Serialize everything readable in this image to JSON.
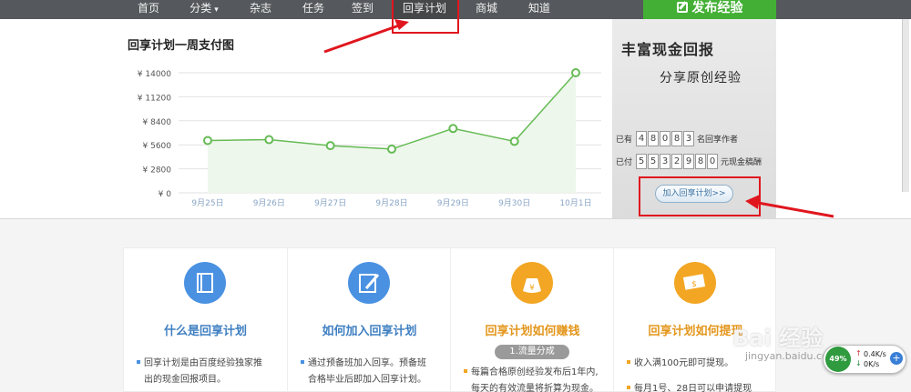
{
  "nav": {
    "items": [
      {
        "label": "首页",
        "has_caret": false,
        "active": false
      },
      {
        "label": "分类",
        "has_caret": true,
        "active": false
      },
      {
        "label": "杂志",
        "has_caret": false,
        "active": false
      },
      {
        "label": "任务",
        "has_caret": false,
        "active": false
      },
      {
        "label": "签到",
        "has_caret": false,
        "active": false
      },
      {
        "label": "回享计划",
        "has_caret": false,
        "active": true
      },
      {
        "label": "商城",
        "has_caret": false,
        "active": false
      },
      {
        "label": "知道",
        "has_caret": false,
        "active": false
      }
    ],
    "publish_label": "发布经验"
  },
  "chart_title": "回享计划一周支付图",
  "chart_data": {
    "type": "area",
    "categories": [
      "9月25日",
      "9月26日",
      "9月27日",
      "9月28日",
      "9月29日",
      "9月30日",
      "10月1日"
    ],
    "values": [
      6100,
      6200,
      5500,
      5100,
      7500,
      6000,
      14000
    ],
    "yticks": [
      "¥ 0",
      "¥ 2800",
      "¥ 5600",
      "¥ 8400",
      "¥ 11200",
      "¥ 14000"
    ],
    "ylim": [
      0,
      14000
    ],
    "line_color": "#66bb55",
    "fill_color": "#eef7ec",
    "grid": true
  },
  "promo": {
    "line1": "丰富现金回报",
    "line2": "分享原创经验",
    "author_prefix": "已有",
    "author_digits": [
      "4",
      "8",
      "0",
      "8",
      "3"
    ],
    "author_suffix": "名回享作者",
    "paid_prefix": "已付",
    "paid_digits": [
      "5",
      "5",
      "3",
      "2",
      "9",
      "8",
      "0"
    ],
    "paid_suffix": "元现金稿酬",
    "join_label": "加入回享计划>>"
  },
  "cards": [
    {
      "title": "什么是回享计划",
      "icon": "book-icon",
      "color": "blue",
      "lines": [
        "回享计划是由百度经验独家推",
        "出的现金回报项目。"
      ]
    },
    {
      "title": "如何加入回享计划",
      "icon": "edit-icon",
      "color": "blue",
      "lines": [
        "通过预备班加入回享。预备班",
        "合格毕业后即加入回享计划。"
      ]
    },
    {
      "title": "回享计划如何赚钱",
      "icon": "money-bag-icon",
      "color": "orange",
      "badge": "1.流量分成",
      "lines": [
        "每篇合格原创经验发布后1年内,",
        "每天的有效流量将折算为现金。"
      ]
    },
    {
      "title": "回享计划如何提现",
      "icon": "cash-icon",
      "color": "orange",
      "lines": [
        "收入满100元即可提现。",
        "每月1号、28日可以申请提现"
      ]
    }
  ],
  "watermark": {
    "brand": "Bai 经验",
    "url": "jingyan.baidu.com"
  },
  "netwidget": {
    "percent": "49%",
    "up": "0.4K/s",
    "down": "0K/s"
  },
  "colors": {
    "accent_green": "#43b035",
    "annotation_red": "#e0161e",
    "link_blue": "#3f73a1"
  }
}
